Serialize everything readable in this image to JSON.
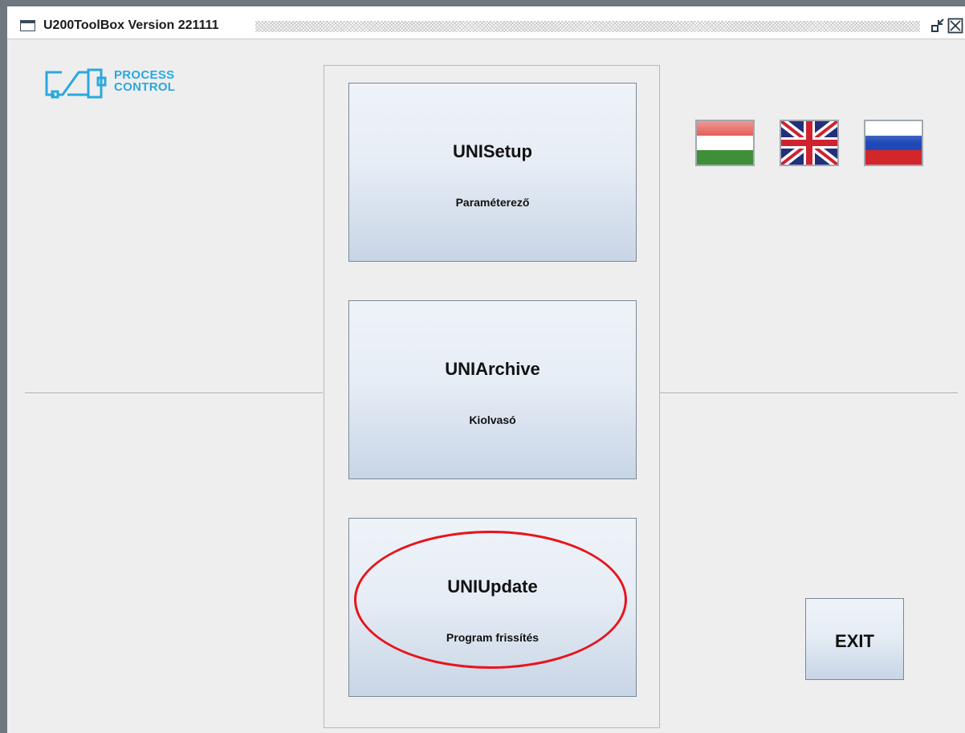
{
  "window": {
    "title": "U200ToolBox Version 221111"
  },
  "logo": {
    "line1": "PROCESS",
    "line2": "CONTROL",
    "color": "#2aa8df"
  },
  "apps": [
    {
      "title": "UNISetup",
      "subtitle": "Paraméterező"
    },
    {
      "title": "UNIArchive",
      "subtitle": "Kiolvasó"
    },
    {
      "title": "UNIUpdate",
      "subtitle": "Program frissítés",
      "highlighted": true
    }
  ],
  "languages": [
    {
      "code": "hu",
      "icon": "flag-hungary-icon"
    },
    {
      "code": "en",
      "icon": "flag-uk-icon"
    },
    {
      "code": "ru",
      "icon": "flag-russia-icon"
    }
  ],
  "exit_label": "EXIT",
  "colors": {
    "highlight": "#e8141c",
    "button_gradient_top": "#eef3f8",
    "button_gradient_bottom": "#c8d5e6"
  }
}
